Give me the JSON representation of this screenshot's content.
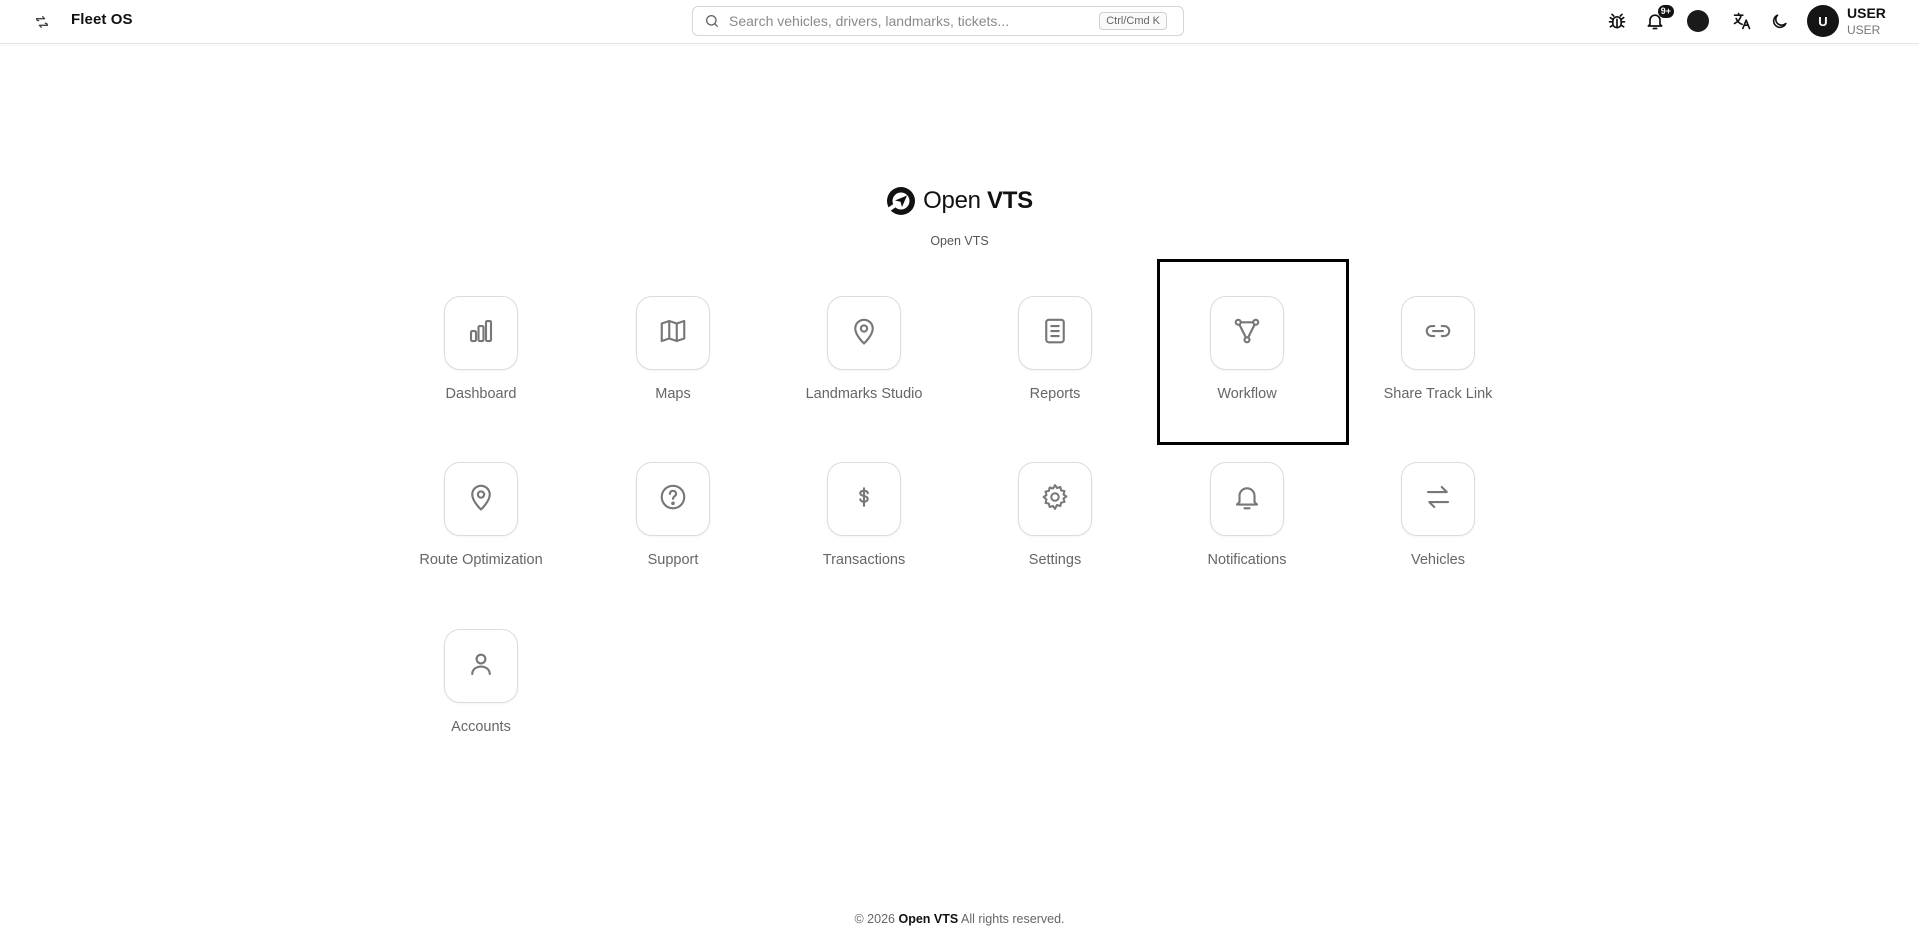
{
  "header": {
    "app_name": "Fleet OS",
    "search_placeholder": "Search vehicles, drivers, landmarks, tickets...",
    "search_shortcut": "Ctrl/Cmd K",
    "notification_count": "9+",
    "user_initial": "U",
    "user_name": "USER",
    "user_role": "USER"
  },
  "brand": {
    "name_light": "Open ",
    "name_bold": "VTS",
    "subtitle": "Open VTS"
  },
  "modules": [
    {
      "label": "Dashboard",
      "icon": "bar-chart-icon"
    },
    {
      "label": "Maps",
      "icon": "map-icon"
    },
    {
      "label": "Landmarks Studio",
      "icon": "map-pin-icon"
    },
    {
      "label": "Reports",
      "icon": "document-icon"
    },
    {
      "label": "Workflow",
      "icon": "workflow-icon"
    },
    {
      "label": "Share Track Link",
      "icon": "link-icon"
    },
    {
      "label": "Route Optimization",
      "icon": "map-pin-icon"
    },
    {
      "label": "Support",
      "icon": "help-circle-icon"
    },
    {
      "label": "Transactions",
      "icon": "dollar-icon"
    },
    {
      "label": "Settings",
      "icon": "gear-icon"
    },
    {
      "label": "Notifications",
      "icon": "bell-icon"
    },
    {
      "label": "Vehicles",
      "icon": "swap-arrows-icon"
    },
    {
      "label": "Accounts",
      "icon": "user-icon"
    }
  ],
  "footer": {
    "prefix": "© 2026 ",
    "brand": "Open VTS",
    "suffix": " All rights reserved."
  },
  "colors": {
    "accent": "#111111",
    "icon_gray": "#777777",
    "highlight_border": "#000000"
  }
}
